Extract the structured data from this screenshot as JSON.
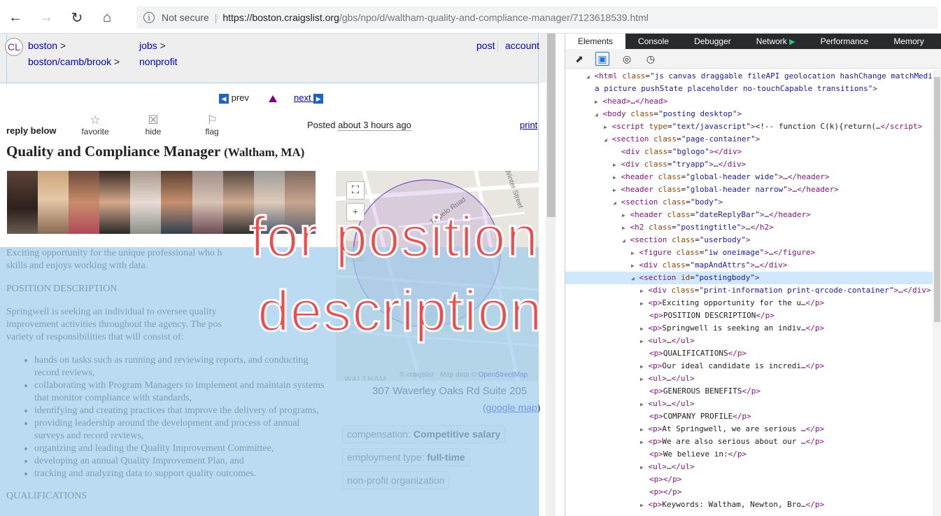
{
  "browser": {
    "not_secure": "Not secure",
    "url_host": "https://boston.craigslist.org",
    "url_path": "/gbs/npo/d/waltham-quality-and-compliance-manager/7123618539.html"
  },
  "header": {
    "logo": "CL",
    "crumb1": "boston",
    "crumb2": "boston/camb/brook",
    "crumb3": "jobs",
    "crumb4": "nonprofit",
    "gt": ">",
    "post": "post",
    "account": "account"
  },
  "pager": {
    "prev": "prev",
    "next": "next"
  },
  "actions": {
    "reply_below": "reply below",
    "favorite": "favorite",
    "hide": "hide",
    "flag": "flag",
    "posted_prefix": "Posted",
    "posted_time": "about 3 hours ago",
    "print": "print"
  },
  "posting": {
    "title": "Quality and Compliance Manager",
    "location": "(Waltham, MA)",
    "p1": "Exciting opportunity for the unique professional who h... skills and enjoys working with data.",
    "p1a": "Exciting opportunity for the unique professional who h",
    "p1b": "al",
    "p1c": "skills and enjoys working with data.",
    "heading1": "POSITION DESCRIPTION",
    "p2a": "Springwell is seeking an individual to oversee quality",
    "p2b": "improvement activities throughout the agency. The pos",
    "p2c": "variety of responsibilities that will consist of:",
    "bullets": [
      "hands on tasks such as running and reviewing reports, and conducting record reviews,",
      "collaborating with Program Managers to implement and maintain systems that monitor compliance with standards,",
      "identifying and creating practices that improve the delivery of programs,",
      "providing leadership around the development and process of annual surveys and record reviews,",
      "organizing and leading the Quality Improvement Committee,",
      "developing an annual Quality Improvement Plan, and",
      "tracking and analyzing data to support quality outcomes."
    ],
    "heading2": "QUALIFICATIONS"
  },
  "map": {
    "street1": "Trapelo Road",
    "street2": "Winter Street",
    "town": "WALTHAM",
    "credit_prefix": "© craigslist - Map data ©",
    "credit_link": "OpenStreetMap",
    "address": "307 Waverley Oaks Rd Suite 205",
    "gmap_open": "(",
    "gmap_link": "google map",
    "gmap_close": ")"
  },
  "attrs": {
    "comp_label": "compensation:",
    "comp_value": "Competitive salary",
    "emp_label": "employment type:",
    "emp_value": "full-time",
    "npo": "non-profit organization"
  },
  "overlay": {
    "line1": "for position",
    "line2": "description"
  },
  "devtools": {
    "tabs": [
      "Elements",
      "Console",
      "Debugger",
      "Network",
      "Performance",
      "Memory"
    ]
  },
  "colors": {
    "overlay": "#ef4b4b",
    "highlight": "#a0cdeb",
    "link": "#0000cc",
    "tag": "#881280",
    "attr": "#994500",
    "value": "#1a1aa6"
  }
}
